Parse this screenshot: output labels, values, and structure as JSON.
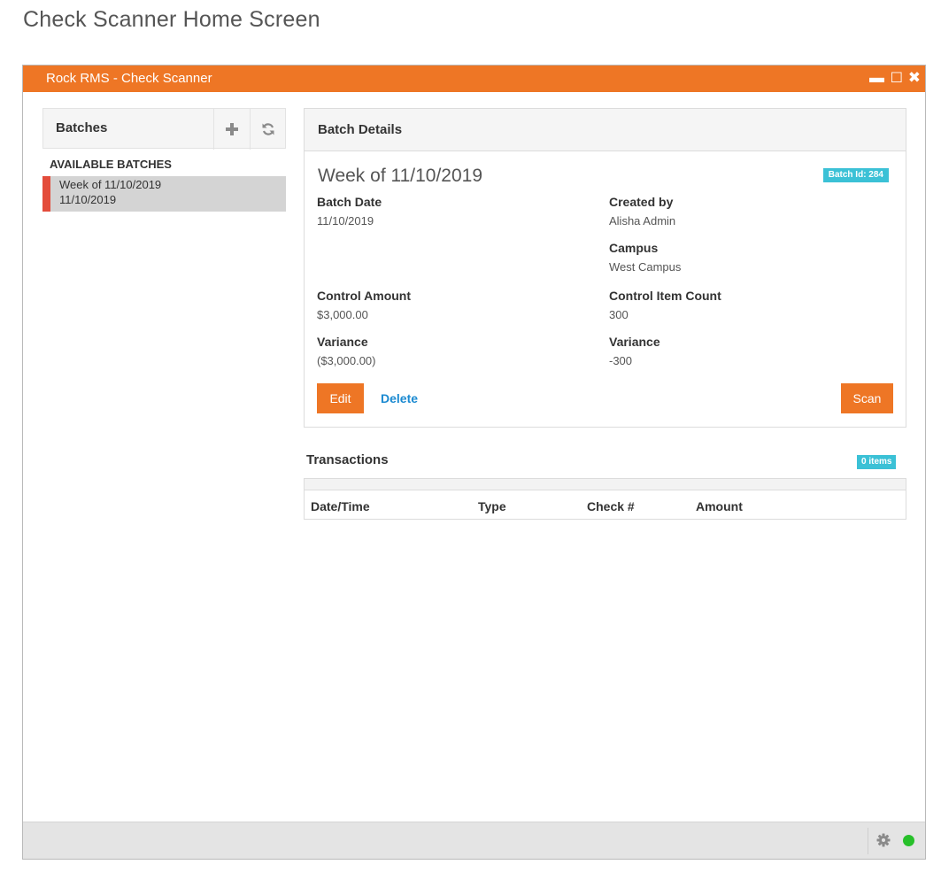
{
  "page_title": "Check Scanner Home Screen",
  "window": {
    "title": "Rock RMS - Check Scanner",
    "controls": {
      "minimize": "▬",
      "maximize": "☐",
      "close": "✖"
    }
  },
  "sidebar": {
    "header": "Batches",
    "add_icon": "plus-icon",
    "refresh_icon": "refresh-icon",
    "section_label": "AVAILABLE BATCHES",
    "items": [
      {
        "name": "Week of 11/10/2019",
        "date": "11/10/2019",
        "selected": true,
        "accent_color": "#e34c3b"
      }
    ]
  },
  "batch_details": {
    "header": "Batch Details",
    "title": "Week of 11/10/2019",
    "batch_id_badge": "Batch Id: 284",
    "batch_date_label": "Batch Date",
    "batch_date_value": "11/10/2019",
    "created_by_label": "Created by",
    "created_by_value": "Alisha Admin",
    "campus_label": "Campus",
    "campus_value": "West Campus",
    "control_amount_label": "Control Amount",
    "control_amount_value": "$3,000.00",
    "control_item_count_label": "Control Item Count",
    "control_item_count_value": "300",
    "variance_amount_label": "Variance",
    "variance_amount_value": "($3,000.00)",
    "variance_count_label": "Variance",
    "variance_count_value": "-300",
    "edit_label": "Edit",
    "delete_label": "Delete",
    "scan_label": "Scan"
  },
  "transactions": {
    "header": "Transactions",
    "count_badge": "0 items",
    "columns": [
      "Date/Time",
      "Type",
      "Check #",
      "Amount"
    ],
    "rows": []
  },
  "status_bar": {
    "settings_icon": "gear-icon",
    "connection_status_color": "#27c02a"
  },
  "colors": {
    "accent": "#ee7625",
    "badge": "#3bc1d6",
    "link": "#1b8ad1"
  }
}
